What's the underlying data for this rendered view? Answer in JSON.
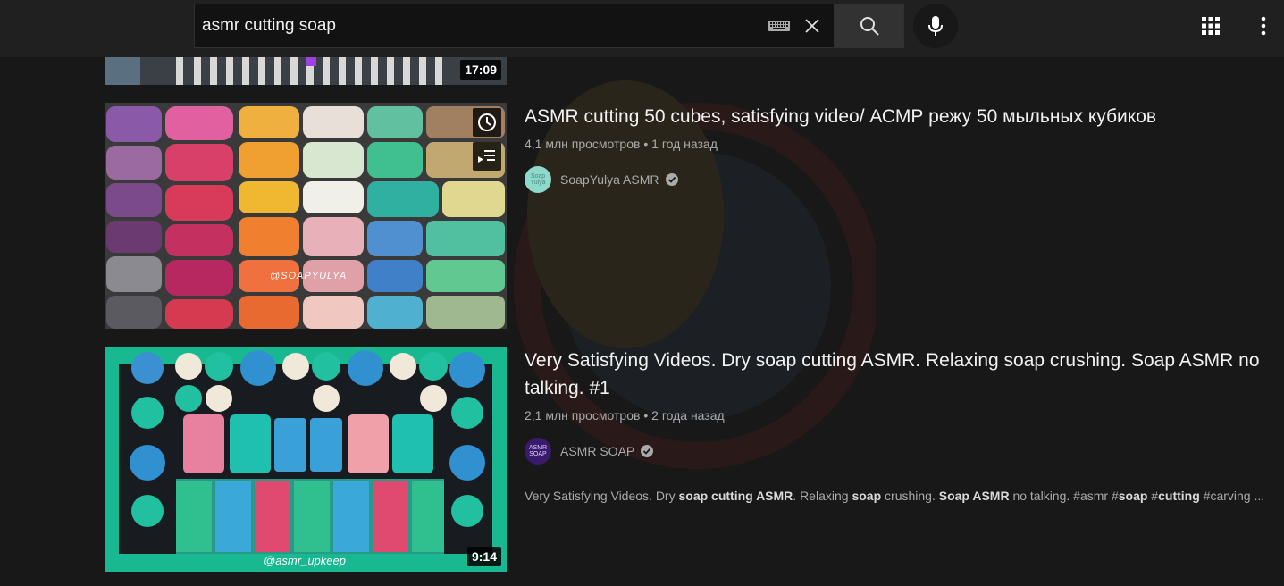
{
  "search": {
    "query": "asmr cutting soap",
    "keyboard_icon": "keyboard-icon",
    "clear_icon": "close-icon",
    "search_icon": "search-icon",
    "mic_icon": "microphone-icon"
  },
  "header": {
    "apps_icon": "apps-grid-icon",
    "more_icon": "more-vertical-icon"
  },
  "results": [
    {
      "duration": "17:09"
    },
    {
      "title": "ASMR cutting 50 cubes, satisfying video/ АСМР режу 50 мыльных кубиков",
      "views": "4,1 млн просмотров",
      "separator": "•",
      "age": "1 год назад",
      "channel": "SoapYulya ASMR",
      "watermark_text": "@SOAPYULYA",
      "avatar_text": "Soap Yulya"
    },
    {
      "title": "Very Satisfying Videos. Dry soap cutting ASMR. Relaxing soap crushing. Soap ASMR no talking. #1",
      "views": "2,1 млн просмотров",
      "separator": "•",
      "age": "2 года назад",
      "channel": "ASMR SOAP",
      "duration": "9:14",
      "watermark_text": "@asmr_upkeep",
      "avatar_text": "ASMR SOAP",
      "snippet": {
        "p1": "Very Satisfying Videos. Dry ",
        "b1": "soap cutting ASMR",
        "p2": ". Relaxing ",
        "b2": "soap",
        "p3": " crushing. ",
        "b3": "Soap ASMR",
        "p4": " no talking. #asmr #",
        "b4": "soap",
        "p5": " #",
        "b5": "cutting",
        "p6": " #carving ..."
      }
    }
  ],
  "colors": {
    "background": "#181818",
    "masthead": "#202020",
    "text_primary": "#f1f1f1",
    "text_secondary": "#aaaaaa"
  }
}
